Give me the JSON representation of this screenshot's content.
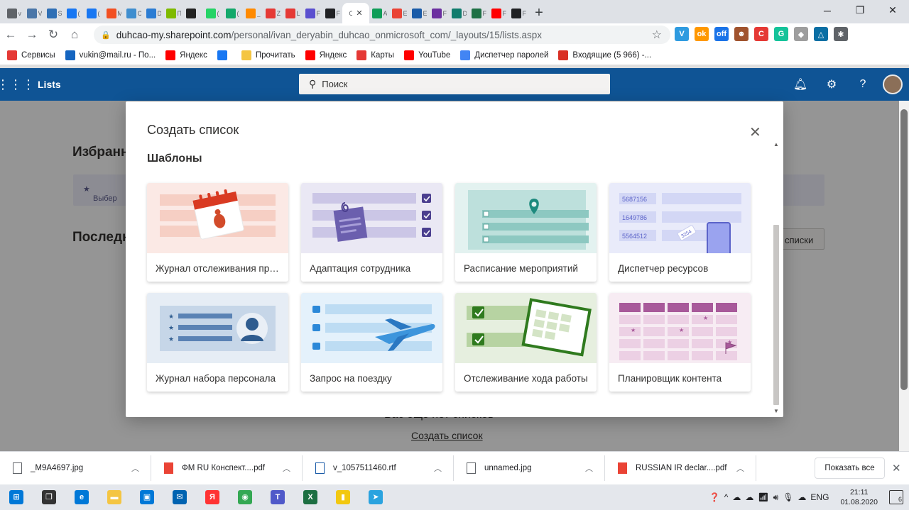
{
  "browser": {
    "tabs": [
      {
        "label": "v",
        "color": "#5f6368"
      },
      {
        "label": "Vk",
        "color": "#4a76a8"
      },
      {
        "label": "S",
        "color": "#2f6fb5"
      },
      {
        "label": "(",
        "color": "#1877f2"
      },
      {
        "label": "(",
        "color": "#1877f2"
      },
      {
        "label": "M",
        "color": "#f25022"
      },
      {
        "label": "C",
        "color": "#3f8ecf"
      },
      {
        "label": "De",
        "color": "#2b7cd3"
      },
      {
        "label": "П",
        "color": "#7fba00"
      },
      {
        "label": "",
        "color": "#222222"
      },
      {
        "label": "(",
        "color": "#25d366"
      },
      {
        "label": "(",
        "color": "#13a86b"
      },
      {
        "label": "_",
        "color": "#ff8a00"
      },
      {
        "label": "Z",
        "color": "#e53935"
      },
      {
        "label": "L",
        "color": "#e53935"
      },
      {
        "label": "F",
        "color": "#5a4fcf"
      },
      {
        "label": "F",
        "color": "#202124"
      }
    ],
    "active_tab": {
      "label": "C",
      "close": "✕"
    },
    "tabs_after": [
      {
        "label": "A",
        "color": "#0f9d58"
      },
      {
        "label": "E",
        "color": "#ea4335"
      },
      {
        "label": "E",
        "color": "#1a5ba8"
      },
      {
        "label": "F",
        "color": "#6b2fa0"
      },
      {
        "label": "D",
        "color": "#107c6d"
      },
      {
        "label": "F",
        "color": "#1e7145"
      },
      {
        "label": "F",
        "color": "#ff0000"
      },
      {
        "label": "F",
        "color": "#202124"
      }
    ],
    "new_tab": "+",
    "window_controls": {
      "minimize": "─",
      "maximize": "❐",
      "close": "✕"
    },
    "nav": {
      "back": "←",
      "forward": "→",
      "reload": "↻",
      "home": "⌂"
    },
    "url_host": "duhcao-my.sharepoint.com",
    "url_path": "/personal/ivan_deryabin_duhcao_onmicrosoft_com/_layouts/15/lists.aspx",
    "extensions": [
      {
        "label": "V",
        "color": "#2f9be0"
      },
      {
        "label": "ok",
        "color": "#ff9800"
      },
      {
        "label": "off",
        "color": "#1a73e8"
      },
      {
        "label": "☻",
        "color": "#a0522d"
      },
      {
        "label": "C",
        "color": "#e53935"
      },
      {
        "label": "G",
        "color": "#15c39a"
      },
      {
        "label": "◆",
        "color": "#9e9e9e"
      },
      {
        "label": "△",
        "color": "#0b6fa4"
      },
      {
        "label": "✱",
        "color": "#5f6368"
      }
    ]
  },
  "bookmarks": [
    {
      "label": "Сервисы",
      "icon": "apps-icon",
      "color": "#e53935"
    },
    {
      "label": "vukin@mail.ru - По...",
      "icon": "mail-icon",
      "color": "#1565c0"
    },
    {
      "label": "Яндекс",
      "icon": "yandex-icon",
      "color": "#ff0000"
    },
    {
      "label": "",
      "icon": "facebook-icon",
      "color": "#1877f2"
    },
    {
      "label": "Прочитать",
      "icon": "folder-icon",
      "color": "#f4c542"
    },
    {
      "label": "Яндекс",
      "icon": "yandex-icon",
      "color": "#ff0000"
    },
    {
      "label": "Карты",
      "icon": "maps-icon",
      "color": "#e53935"
    },
    {
      "label": "YouTube",
      "icon": "youtube-icon",
      "color": "#ff0000"
    },
    {
      "label": "Диспетчер паролей",
      "icon": "google-icon",
      "color": "#4285f4"
    },
    {
      "label": "Входящие (5 966) -...",
      "icon": "gmail-icon",
      "color": "#d93025"
    }
  ],
  "suite": {
    "app_title": "Lists",
    "search_placeholder": "Поиск"
  },
  "background": {
    "favorites_heading": "Избранн",
    "favorites_hint": "Выбер",
    "recent_heading": "Последн",
    "button_partial": "списки",
    "empty_text": "Вас еще нет списков",
    "create_link": "Создать список"
  },
  "dialog": {
    "title": "Создать список",
    "close": "✕",
    "section": "Шаблоны",
    "cards": [
      {
        "label": "Журнал отслеживания проблем",
        "bg": "#fbe9e5"
      },
      {
        "label": "Адаптация сотрудника",
        "bg": "#eae8f4"
      },
      {
        "label": "Расписание мероприятий",
        "bg": "#e3f2f0"
      },
      {
        "label": "Диспетчер ресурсов",
        "bg": "#e9ebfa"
      },
      {
        "label": "Журнал набора персонала",
        "bg": "#e6edf5"
      },
      {
        "label": "Запрос на поездку",
        "bg": "#e4f1fb"
      },
      {
        "label": "Отслеживание хода работы",
        "bg": "#e6efdf"
      },
      {
        "label": "Планировщик контента",
        "bg": "#f7ecf3"
      }
    ],
    "resource_numbers": [
      "5687156",
      "1649786",
      "5564512"
    ],
    "tag_number": "3254"
  },
  "downloads": {
    "items": [
      {
        "name": "_M9A4697.jpg",
        "type": "jpg"
      },
      {
        "name": "ФМ RU Конспект....pdf",
        "type": "pdf"
      },
      {
        "name": "v_1057511460.rtf",
        "type": "rtf"
      },
      {
        "name": "unnamed.jpg",
        "type": "jpg"
      },
      {
        "name": "RUSSIAN IR declar....pdf",
        "type": "pdf"
      }
    ],
    "show_all": "Показать все",
    "close": "✕"
  },
  "taskbar": {
    "apps": [
      {
        "name": "start",
        "color": "#0078d7",
        "glyph": "⊞"
      },
      {
        "name": "task-view",
        "color": "#333333",
        "glyph": "❒"
      },
      {
        "name": "edge",
        "color": "#0078d7",
        "glyph": "e"
      },
      {
        "name": "explorer",
        "color": "#f4c542",
        "glyph": "▬"
      },
      {
        "name": "store",
        "color": "#0078d7",
        "glyph": "▣"
      },
      {
        "name": "mail",
        "color": "#0063b1",
        "glyph": "✉"
      },
      {
        "name": "yandex",
        "color": "#ff3333",
        "glyph": "Я"
      },
      {
        "name": "chrome",
        "color": "#34a853",
        "glyph": "◉"
      },
      {
        "name": "teams",
        "color": "#5059c9",
        "glyph": "T"
      },
      {
        "name": "excel",
        "color": "#1d6f42",
        "glyph": "X"
      },
      {
        "name": "powerbi",
        "color": "#f2c811",
        "glyph": "▮"
      },
      {
        "name": "telegram",
        "color": "#2aa3df",
        "glyph": "➤"
      }
    ],
    "lang": "ENG",
    "time": "21:11",
    "date": "01.08.2020",
    "notifications": "6"
  }
}
